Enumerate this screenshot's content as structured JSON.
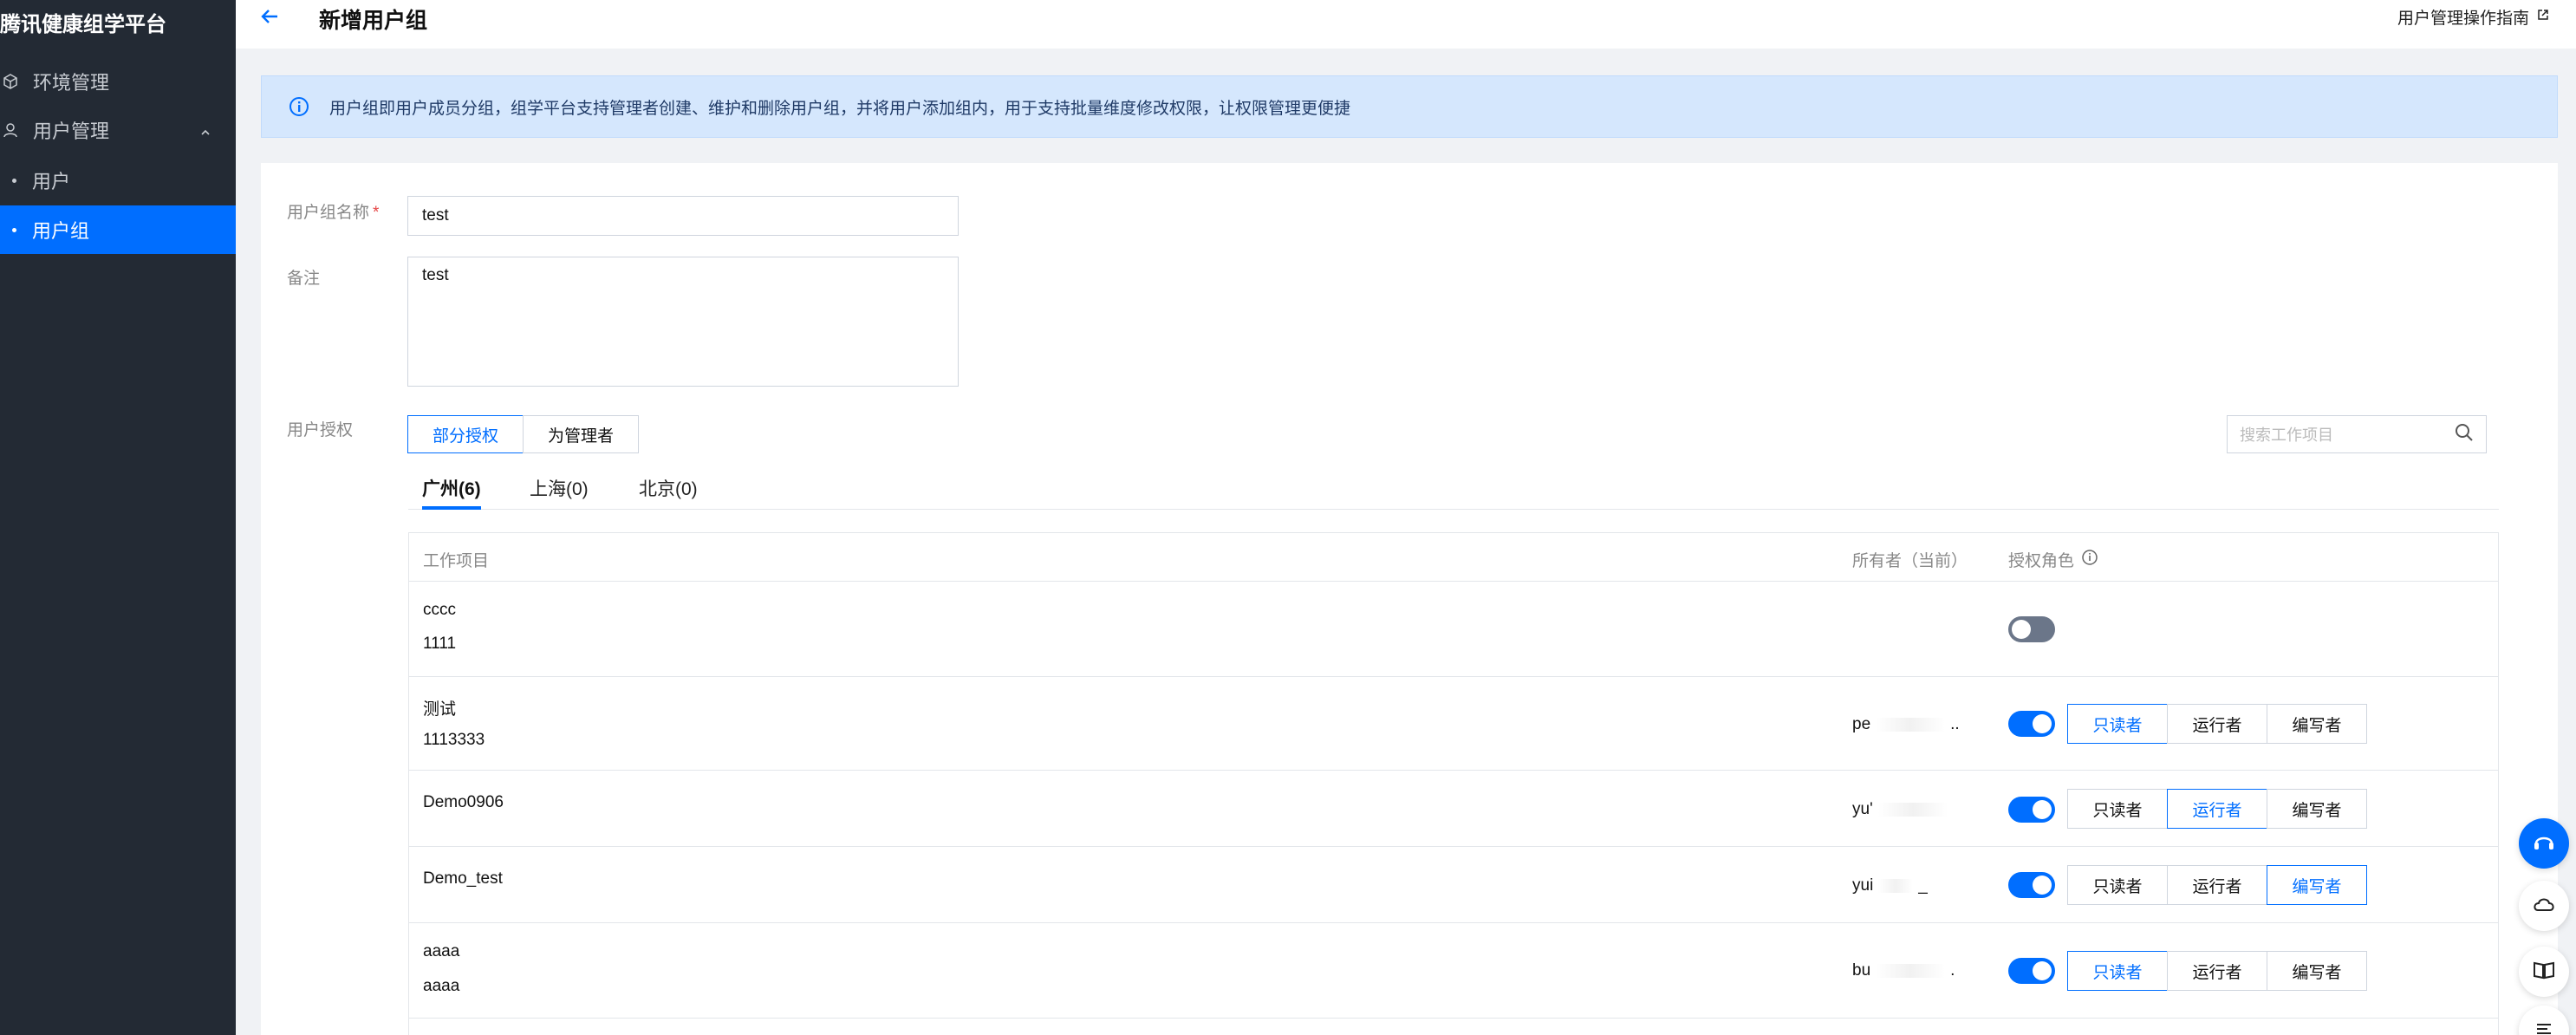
{
  "sidebar": {
    "brand": "腾讯健康组学平台",
    "items": [
      {
        "label": "环境管理",
        "icon": "cube-icon"
      },
      {
        "label": "用户管理",
        "icon": "user-icon"
      },
      {
        "label": "用户"
      },
      {
        "label": "用户组"
      }
    ],
    "active_item": "用户组"
  },
  "header": {
    "title": "新增用户组",
    "guide_link": "用户管理操作指南"
  },
  "banner": {
    "text": "用户组即用户成员分组，组学平台支持管理者创建、维护和删除用户组，并将用户添加组内，用于支持批量维度修改权限，让权限管理更便捷"
  },
  "form": {
    "name_label": "用户组名称",
    "name_value": "test",
    "note_label": "备注",
    "note_value": "test",
    "auth_label": "用户授权",
    "auth_options": [
      "部分授权",
      "为管理者"
    ],
    "auth_selected": "部分授权",
    "search_placeholder": "搜索工作项目"
  },
  "tabs": [
    "广州(6)",
    "上海(0)",
    "北京(0)"
  ],
  "active_tab": "广州(6)",
  "table": {
    "headers": {
      "project": "工作项目",
      "owner": "所有者（当前）",
      "role": "授权角色"
    },
    "role_options": [
      "只读者",
      "运行者",
      "编写者"
    ],
    "rows": [
      {
        "name": "cccc",
        "id": "1111",
        "owner_prefix": "",
        "owner_suffix": "",
        "enabled": false,
        "role": ""
      },
      {
        "name": "测试",
        "id": "1113333",
        "owner_prefix": "pe",
        "owner_suffix": "..",
        "enabled": true,
        "role": "只读者"
      },
      {
        "name": "Demo0906",
        "id": "",
        "owner_prefix": "yu'",
        "owner_suffix": "",
        "enabled": true,
        "role": "运行者"
      },
      {
        "name": "Demo_test",
        "id": "",
        "owner_prefix": "yui",
        "owner_suffix": "_",
        "enabled": true,
        "role": "编写者"
      },
      {
        "name": "aaaa",
        "id": "aaaa",
        "owner_prefix": "bu",
        "owner_suffix": ".",
        "enabled": true,
        "role": "只读者"
      }
    ]
  },
  "colors": {
    "accent": "#006eff",
    "sidebar_bg": "#232a34",
    "banner_bg": "#d5e7fd"
  }
}
